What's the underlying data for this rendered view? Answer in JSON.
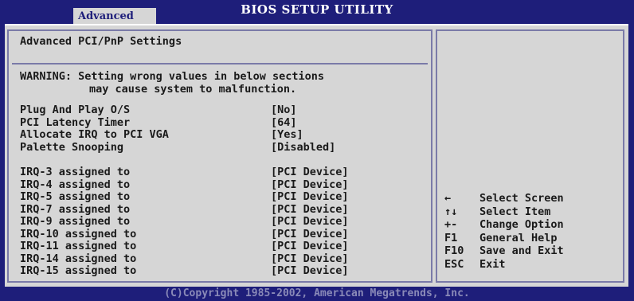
{
  "header": {
    "title": "BIOS SETUP UTILITY",
    "tab": "Advanced"
  },
  "main": {
    "section_title": "Advanced PCI/PnP Settings",
    "warning_line1": "WARNING: Setting wrong values in below sections",
    "warning_line2": "may cause system to malfunction.",
    "settings": [
      {
        "label": "Plug And Play O/S",
        "value": "[No]"
      },
      {
        "label": "PCI Latency Timer",
        "value": "[64]"
      },
      {
        "label": "Allocate IRQ to PCI VGA",
        "value": "[Yes]"
      },
      {
        "label": "Palette Snooping",
        "value": "[Disabled]"
      }
    ],
    "irqs": [
      {
        "label": "IRQ-3 assigned to",
        "value": "[PCI Device]"
      },
      {
        "label": "IRQ-4 assigned to",
        "value": "[PCI Device]"
      },
      {
        "label": "IRQ-5 assigned to",
        "value": "[PCI Device]"
      },
      {
        "label": "IRQ-7 assigned to",
        "value": "[PCI Device]"
      },
      {
        "label": "IRQ-9 assigned to",
        "value": "[PCI Device]"
      },
      {
        "label": "IRQ-10 assigned to",
        "value": "[PCI Device]"
      },
      {
        "label": "IRQ-11 assigned to",
        "value": "[PCI Device]"
      },
      {
        "label": "IRQ-14 assigned to",
        "value": "[PCI Device]"
      },
      {
        "label": "IRQ-15 assigned to",
        "value": "[PCI Device]"
      }
    ]
  },
  "help": {
    "items": [
      {
        "key": "←",
        "desc": "Select Screen",
        "icon": "arrow-left-icon"
      },
      {
        "key": "↑↓",
        "desc": "Select Item",
        "icon": "arrow-up-down-icon"
      },
      {
        "key": "+-",
        "desc": "Change Option"
      },
      {
        "key": "F1",
        "desc": "General Help"
      },
      {
        "key": "F10",
        "desc": "Save and Exit"
      },
      {
        "key": "ESC",
        "desc": "Exit"
      }
    ]
  },
  "footer": {
    "copyright": "(C)Copyright 1985-2002, American Megatrends, Inc."
  },
  "colors": {
    "background": "#1e1e7a",
    "panel": "#d6d6d6",
    "frame": "#7a7aa8",
    "text": "#1a1a1a"
  }
}
